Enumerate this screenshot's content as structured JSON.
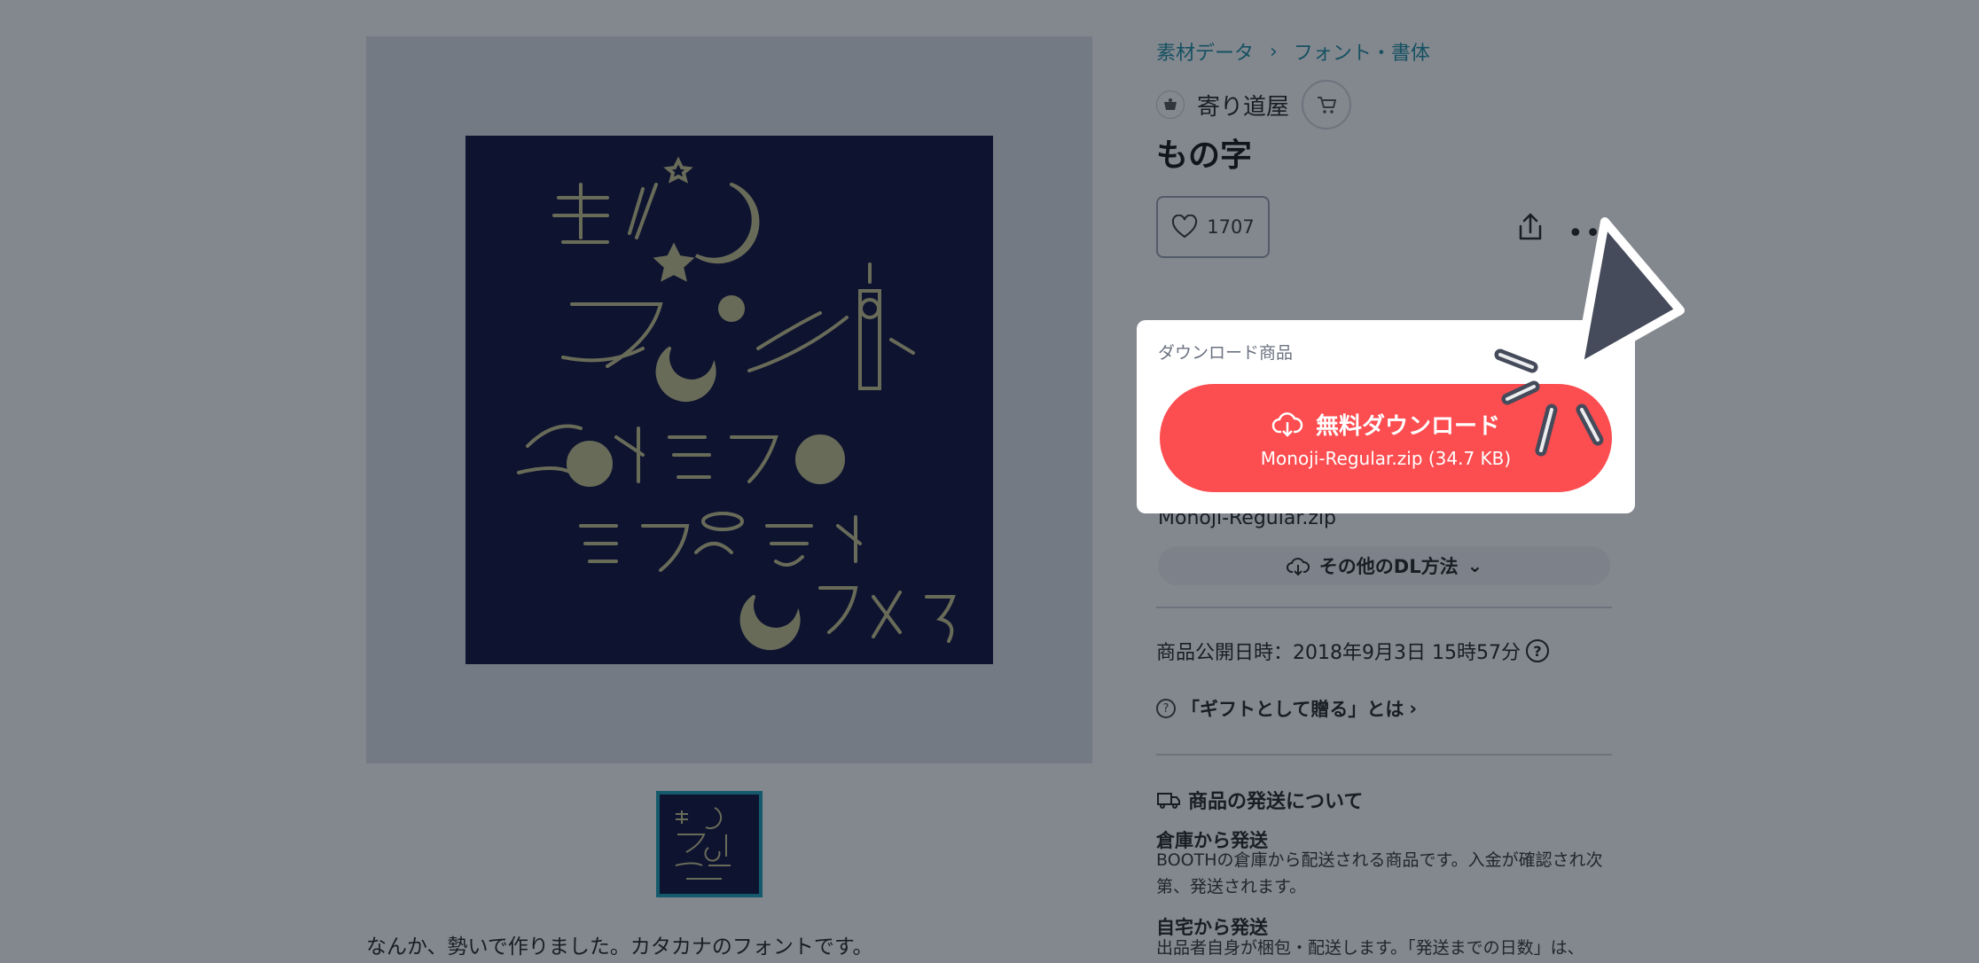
{
  "breadcrumb": [
    "素材データ",
    "フォント・書体"
  ],
  "shop": {
    "name": "寄り道屋"
  },
  "product": {
    "title": "もの字",
    "likes": "1707",
    "description": "なんか、勢いで作りました。カタカナのフォントです。"
  },
  "download": {
    "card_label": "ダウンロード商品",
    "button_label": "無料ダウンロード",
    "button_sub": "Monoji-Regular.zip (34.7 KB)",
    "filename": "Monoji-Regular.zip",
    "other_methods": "その他のDL方法"
  },
  "publish": {
    "text": "商品公開日時：2018年9月3日 15時57分"
  },
  "gift": {
    "text": "「ギフトとして贈る」とは"
  },
  "shipping": {
    "title": "商品の発送について",
    "warehouse_title": "倉庫から発送",
    "warehouse_text": "BOOTHの倉庫から配送される商品です。入金が確認され次第、発送されます。",
    "self_title": "自宅から発送",
    "self_text": "出品者自身が梱包・配送します。「発送までの日数」は、"
  },
  "colors": {
    "accent": "#fc4d50",
    "link": "#1b8fa3",
    "art_bg": "#0b0f3a",
    "art_ink": "#c9c491"
  }
}
